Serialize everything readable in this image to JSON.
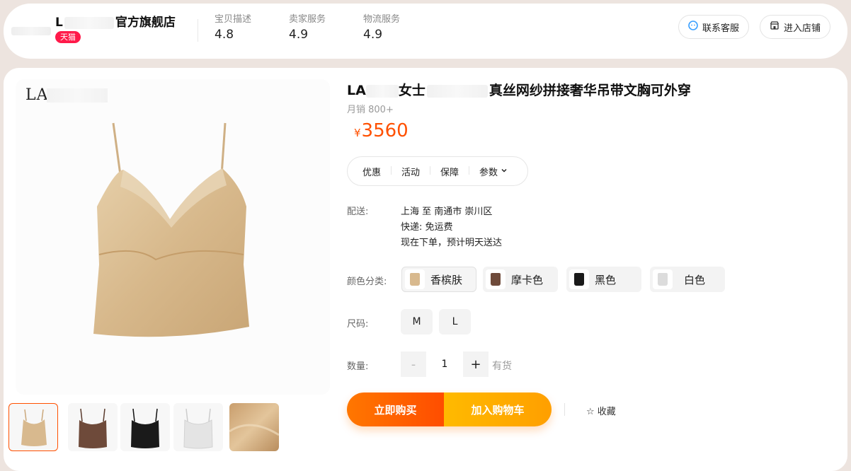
{
  "shop": {
    "name_prefix": "L",
    "name_suffix": "官方旗舰店",
    "badge": "天猫",
    "ratings": [
      {
        "label": "宝贝描述",
        "value": "4.8"
      },
      {
        "label": "卖家服务",
        "value": "4.9"
      },
      {
        "label": "物流服务",
        "value": "4.9"
      }
    ],
    "contact_label": "联系客服",
    "enter_shop_label": "进入店铺"
  },
  "product": {
    "watermark": "LA",
    "title_prefix": "LA",
    "title_mid": "女士",
    "title_suffix": "真丝网纱拼接奢华吊带文胸可外穿",
    "sales": "月销 800+",
    "currency": "¥",
    "price": "3560",
    "tabs": [
      "优惠",
      "活动",
      "保障",
      "参数"
    ],
    "shipping": {
      "label": "配送:",
      "route": "上海 至 南通市 崇川区",
      "express": "快递: 免运费",
      "eta": "现在下单，预计明天送达"
    },
    "color_label": "颜色分类:",
    "colors": [
      {
        "name": "香槟肤",
        "swatch": "#d8b98e"
      },
      {
        "name": "摩卡色",
        "swatch": "#6e4a3a"
      },
      {
        "name": "黑色",
        "swatch": "#1a1a1a"
      },
      {
        "name": "白色",
        "swatch": "#dcdcdc"
      }
    ],
    "size_label": "尺码:",
    "sizes": [
      "M",
      "L"
    ],
    "qty_label": "数量:",
    "qty_minus": "-",
    "qty_value": "1",
    "qty_plus": "+",
    "stock": "有货",
    "buy_now": "立即购买",
    "add_cart": "加入购物车",
    "favorite": "☆ 收藏"
  },
  "colors": {
    "accent": "#ff5000",
    "tmall_red": "#ff1a4a",
    "page_bg": "#ede4df"
  }
}
